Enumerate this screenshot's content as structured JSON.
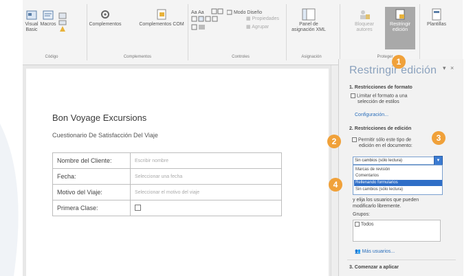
{
  "ribbon": {
    "buttons": [
      {
        "label": "Visual Basic",
        "icon": "vb-icon"
      },
      {
        "label": "Macros",
        "icon": "macros-icon"
      },
      {
        "label": "Complementos",
        "icon": "gear-icon"
      },
      {
        "label": "Complementos COM",
        "icon": "com-addins-icon"
      },
      {
        "label": "Modo Diseño",
        "icon": "design-mode-icon"
      },
      {
        "label": "Propiedades",
        "icon": "properties-icon"
      },
      {
        "label": "Agrupar",
        "icon": "group-icon"
      },
      {
        "label": "Panel de asignación XML",
        "icon": "xml-pane-icon"
      },
      {
        "label": "Bloquear autores",
        "icon": "block-authors-icon"
      },
      {
        "label": "Restringir edición",
        "icon": "restrict-editing-icon"
      },
      {
        "label": "Plantillas",
        "icon": "templates-icon"
      }
    ],
    "groups": {
      "code": "Código",
      "addins": "Complementos",
      "controls": "Controles",
      "mapping": "Asignación",
      "protect": "Proteger"
    }
  },
  "document": {
    "title": "Bon Voyage Excursions",
    "subtitle": "Cuestionario De Satisfacción Del Viaje",
    "rows": [
      {
        "label": "Nombre del Cliente:",
        "value": "Escribir nombre"
      },
      {
        "label": "Fecha:",
        "value": "Seleccionar una fecha"
      },
      {
        "label": "Motivo del Viaje:",
        "value": "Seleccionar el motivo del viaje"
      },
      {
        "label": "Primera Clase:",
        "value": ""
      }
    ]
  },
  "pane": {
    "title": "Restringir edición",
    "close": "×",
    "options": "▾",
    "section1": "1. Restricciones de formato",
    "s1_check": "Limitar el formato a una",
    "s1_check2": "selección de estilos",
    "s1_link": "Configuración...",
    "section2": "2. Restricciones de edición",
    "s2_check": "Permitir sólo este tipo de",
    "s2_check2": "edición en el documento:",
    "dropdown_value": "Sin cambios (sólo lectura)",
    "dropdown_options": [
      "Marcas de revisión",
      "Comentarios",
      "Rellenando formularios",
      "Sin cambios (sólo lectura)"
    ],
    "exceptions1": "y elija los usuarios que pueden",
    "exceptions2": "modificarlo libremente.",
    "groups_label": "Grupos:",
    "everyone": "Todos",
    "more_users": "Más usuarios...",
    "section3": "3. Comenzar a aplicar"
  },
  "callouts": [
    "1",
    "2",
    "3",
    "4"
  ],
  "colors": {
    "accent": "#f0a13a",
    "selection": "#2f6ec7",
    "pane_title": "#8aa1bd"
  }
}
